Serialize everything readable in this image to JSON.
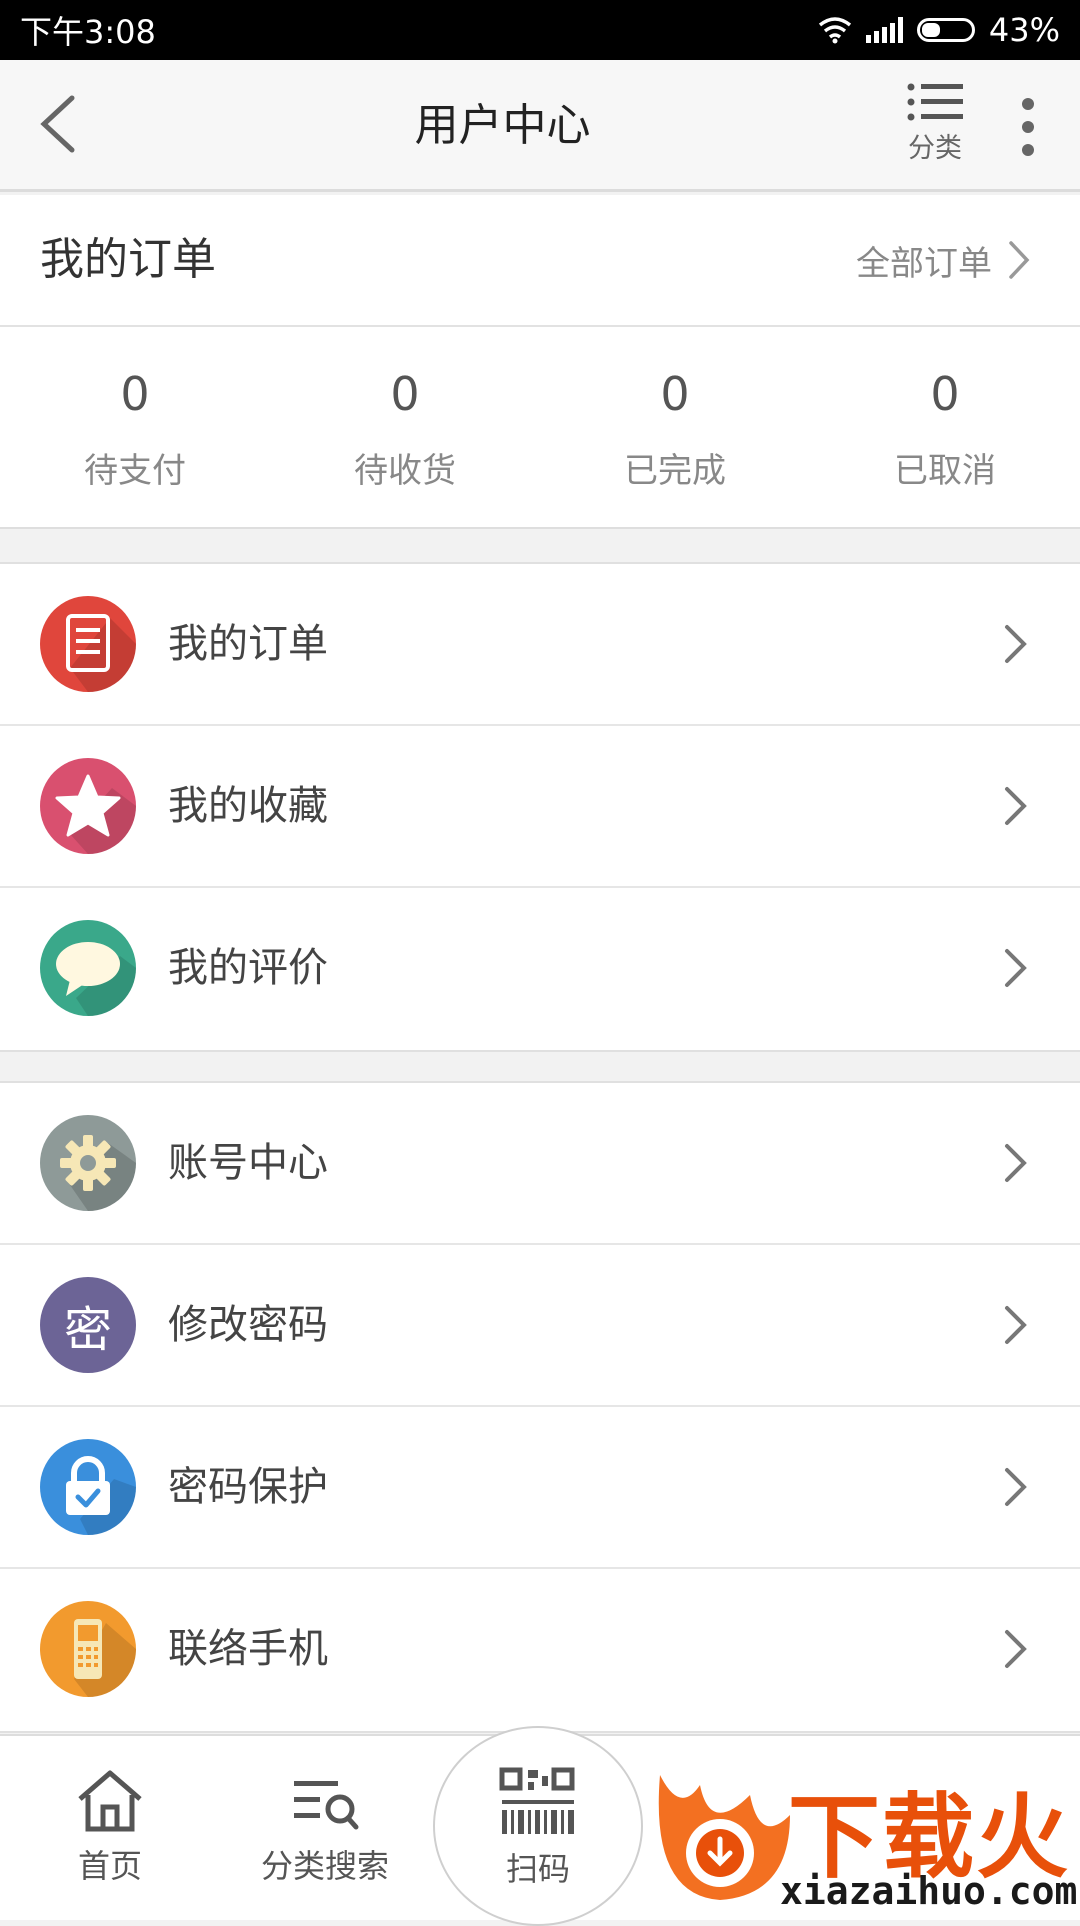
{
  "status_bar": {
    "time": "下午3:08",
    "battery_percent": "43%",
    "battery_level": 0.43
  },
  "nav": {
    "title": "用户中心",
    "category_label": "分类"
  },
  "order_header": {
    "title": "我的订单",
    "all_orders": "全部订单"
  },
  "order_stats": [
    {
      "value": "0",
      "label": "待支付"
    },
    {
      "value": "0",
      "label": "待收货"
    },
    {
      "value": "0",
      "label": "已完成"
    },
    {
      "value": "0",
      "label": "已取消"
    }
  ],
  "menu_group_1": [
    {
      "label": "我的订单",
      "icon": "order-list-icon",
      "color": "#e0463c"
    },
    {
      "label": "我的收藏",
      "icon": "star-icon",
      "color": "#d9506f"
    },
    {
      "label": "我的评价",
      "icon": "chat-bubble-icon",
      "color": "#3aa88a"
    }
  ],
  "menu_group_2": [
    {
      "label": "账号中心",
      "icon": "gear-icon",
      "color": "#8e9a98"
    },
    {
      "label": "修改密码",
      "icon": "password-char-icon",
      "color": "#6c6496",
      "glyph": "密"
    },
    {
      "label": "密码保护",
      "icon": "lock-icon",
      "color": "#3a8fdc"
    },
    {
      "label": "联络手机",
      "icon": "mobile-phone-icon",
      "color": "#f29a2e"
    }
  ],
  "tabbar": {
    "home": "首页",
    "category_search": "分类搜索",
    "scan": "扫码"
  },
  "watermark": {
    "brand": "下载火",
    "url": "xiazaihuo.com"
  }
}
